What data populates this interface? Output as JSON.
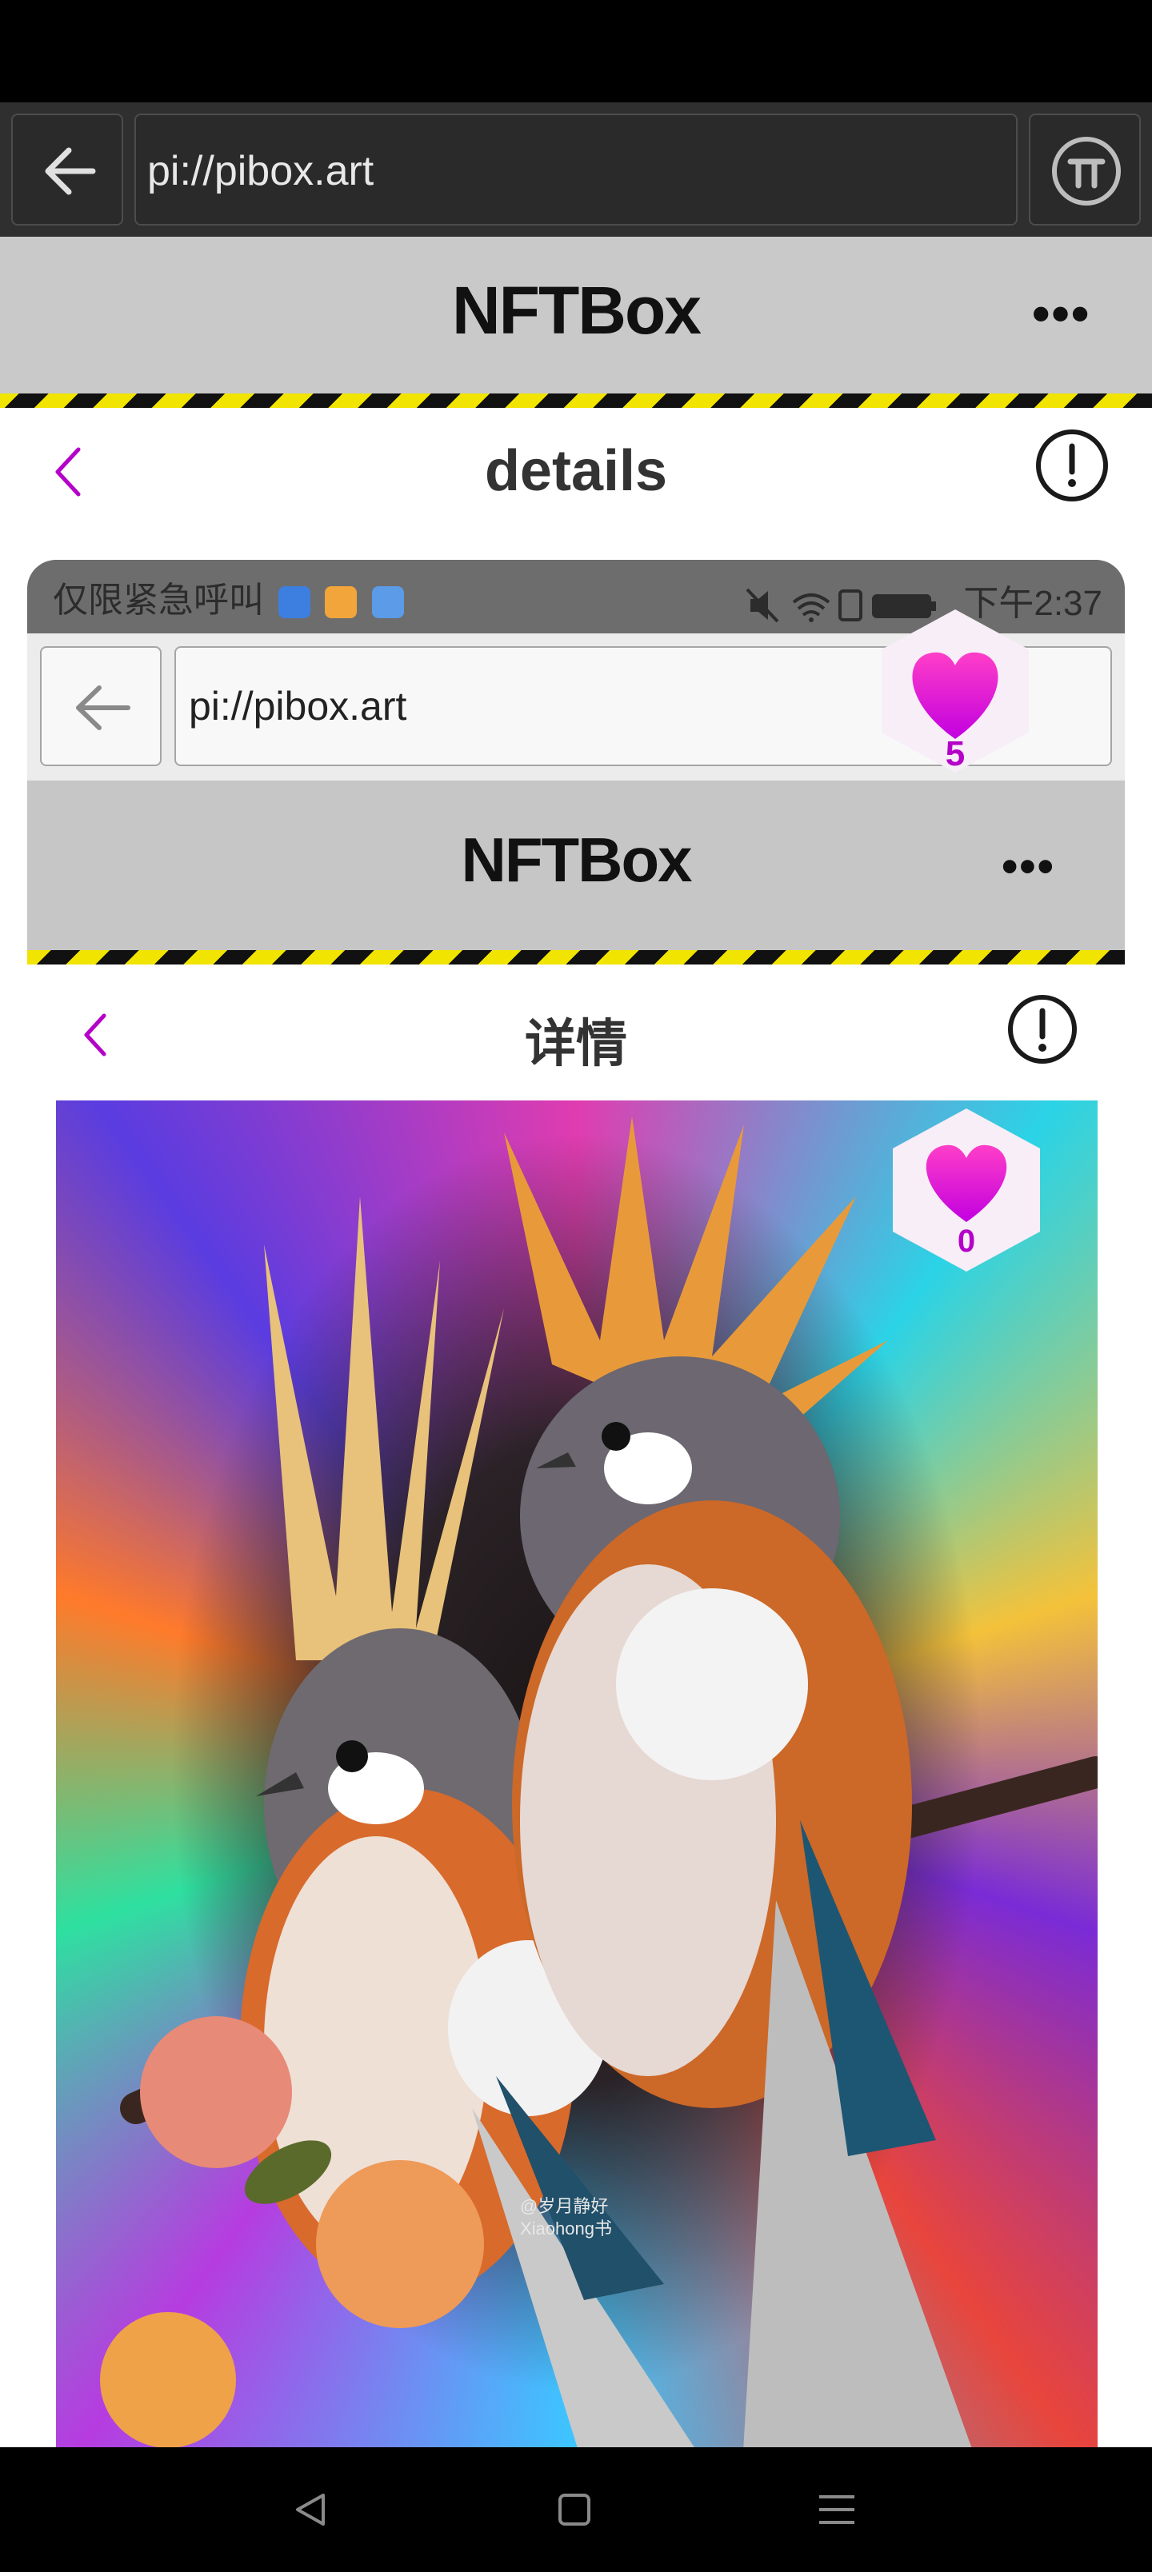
{
  "browser": {
    "url": "pi://pibox.art",
    "icons": [
      "back-arrow-icon",
      "pi-logo-icon"
    ]
  },
  "app": {
    "title": "NFTBox",
    "more_label": "•••"
  },
  "page": {
    "title": "details"
  },
  "inner_screenshot": {
    "status": {
      "left_text": "仅限紧急呼叫",
      "time": "下午2:37",
      "icons": [
        "mute-icon",
        "wifi-icon",
        "sim-icon",
        "battery-icon"
      ]
    },
    "browser": {
      "url": "pi://pibox.art"
    },
    "app": {
      "title": "NFTBox",
      "more_label": "•••"
    },
    "page": {
      "title": "详情"
    },
    "artwork": {
      "watermark": "@岁月静好\nXiaohong书"
    }
  },
  "likes": {
    "top_count": "5",
    "artwork_count": "0"
  },
  "colors": {
    "accent_purple": "#b400c8",
    "heart_gradient": [
      "#ff3ec8",
      "#c200e0"
    ],
    "header_gray": "#c9c9c9",
    "stripe_yellow": "#f1e400"
  },
  "nav": {
    "icons": [
      "back-triangle-icon",
      "home-square-icon",
      "menu-lines-icon"
    ]
  }
}
